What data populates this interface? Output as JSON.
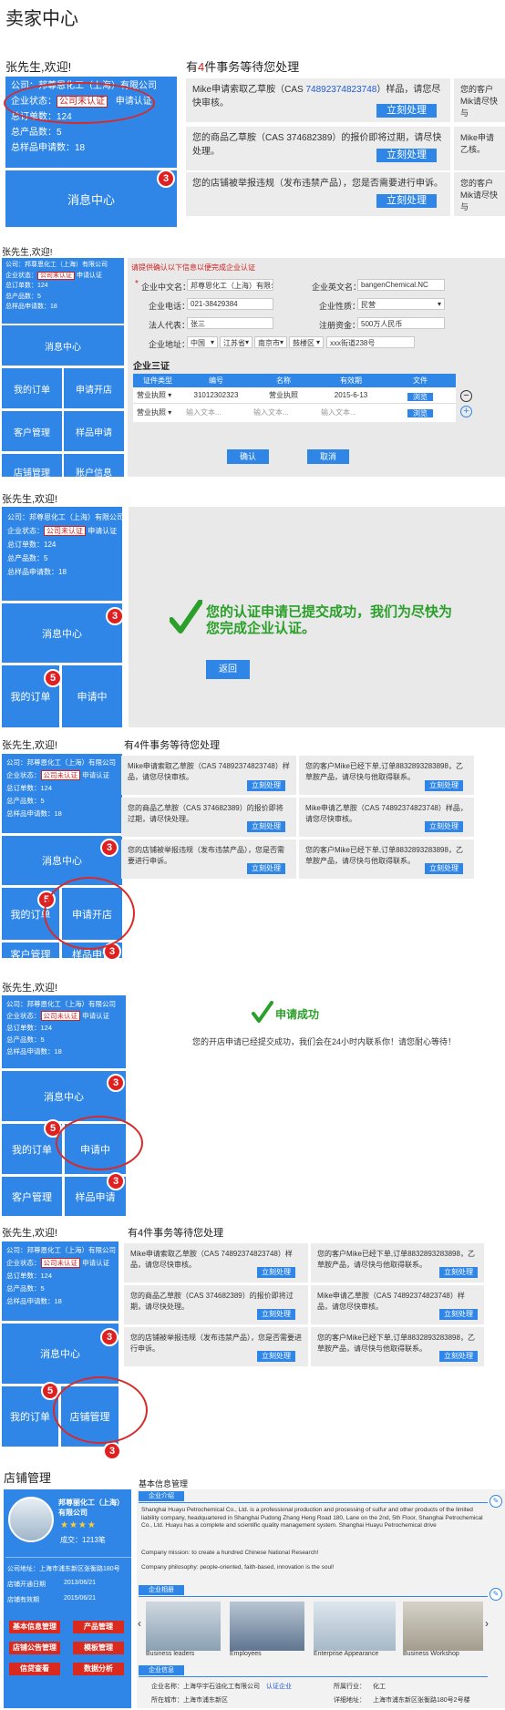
{
  "page_title": "卖家中心",
  "colors": {
    "primary": "#2f86e6",
    "badge": "#e02020",
    "annotation": "#d82a2a",
    "success": "#2aa02a"
  },
  "s1": {
    "greeting": "张先生,欢迎!",
    "company": "公司：邦尊恩化工（上海）有限公司",
    "status_label": "企业状态：",
    "status_value": "公司未认证",
    "apply_cert": "申请认证",
    "orders": "总订单数：124",
    "products": "总产品数：5",
    "samples": "总样品申请数：18",
    "message_center": "消息中心",
    "message_badge": "3",
    "tasks_prefix": "有",
    "tasks_count": "4",
    "tasks_suffix": "件事务等待您处理",
    "card1_a": "Mike申请索取乙草胺（CAS ",
    "card1_cas": "74892374823748",
    "card1_b": "）样品，请您尽快审核。",
    "card2": "您的商品乙草胺（CAS 374682389）的报价即将过期，请尽快处理。",
    "card3": "您的店铺被举报违规（发布违禁产品），您是否需要进行申诉。",
    "side1": "您的客户Mik请尽快与",
    "side2": "Mike申请乙核。",
    "side3": "您的客户Mik请尽快与",
    "process": "立刻处理"
  },
  "s2": {
    "greeting": "张先生,欢迎!",
    "company": "公司：邦尊恩化工（上海）有限公司",
    "status_label": "企业状态：",
    "status_value": "公司未认证",
    "apply_cert": "申请认证",
    "orders": "总订单数：124",
    "products": "总产品数：5",
    "samples": "总样品申请数：18",
    "message_center": "消息中心",
    "my_orders": "我的订单",
    "open_store": "申请开店",
    "customer_mgmt": "客户管理",
    "sample_apply": "样品申请",
    "store_mgmt": "店铺管理",
    "account_info": "账户信息",
    "notice": "请提供确认以下信息以便完成企业认证",
    "f_cn_name": "企业中文名：",
    "v_cn_name": "邦尊恩化工（上海）有限公司",
    "f_en_name": "企业英文名：",
    "v_en_name": "bangenChemical.NC",
    "f_phone": "企业电话：",
    "v_phone": "021-38429384",
    "f_nature": "企业性质：",
    "v_nature": "民营",
    "f_legal": "法人代表：",
    "v_legal": "张三",
    "f_capital": "注册资金：",
    "v_capital": "500万人民币",
    "f_address": "企业地址：",
    "v_country": "中国",
    "v_province": "江苏省",
    "v_city": "南京市",
    "v_district": "鼓楼区",
    "v_street": "xxx街道238号",
    "certs_title": "企业三证",
    "table_headers": [
      "证件类型",
      "编号",
      "名称",
      "有效期",
      "文件"
    ],
    "row1": [
      "营业执照",
      "31012302323",
      "营业执照",
      "2015-6-13",
      "浏览"
    ],
    "row2": [
      "营业执照",
      "输入文本...",
      "输入文本...",
      "输入文本...",
      "浏览"
    ],
    "confirm": "确认",
    "cancel": "取消"
  },
  "s3": {
    "greeting": "张先生,欢迎!",
    "company": "公司：邦尊恩化工（上海）有限公司",
    "status_label": "企业状态：",
    "status_value": "公司未认证",
    "apply_cert": "申请认证",
    "orders": "总订单数：124",
    "products": "总产品数：5",
    "samples": "总样品申请数：18",
    "message_center": "消息中心",
    "my_orders": "我的订单",
    "applying": "申请中",
    "success_msg": "您的认证申请已提交成功，我们为尽快为您完成企业认证。",
    "back": "返回",
    "badge3": "3",
    "badge5": "5"
  },
  "s4": {
    "greeting": "张先生,欢迎!",
    "company": "公司：邦尊恩化工（上海）有限公司",
    "status_label": "企业状态：",
    "status_value": "公司未认证",
    "apply_cert": "申请认证",
    "orders": "总订单数：124",
    "products": "总产品数：5",
    "samples": "总样品申请数：18",
    "message_center": "消息中心",
    "my_orders": "我的订单",
    "open_store": "申请开店",
    "customer_mgmt": "客户管理",
    "sample_apply": "样品申请",
    "tasks": "有4件事务等待您处理",
    "c1": "Mike申请索取乙草胺（CAS 74892374823748）样品，请您尽快审核。",
    "c2": "您的客户Mike已经下单,订单8832893283898，乙草胺产品，请尽快与他取得联系。",
    "c3": "您的商品乙草胺（CAS 374682389）的报价即将过期，请尽快处理。",
    "c4": "Mike申请乙草胺（CAS 74892374823748）样品，请您尽快审核。",
    "c5": "您的店铺被举报违规（发布违禁产品），您是否需要进行申诉。",
    "c6": "您的客户Mike已经下单,订单8832893283898，乙草胺产品，请尽快与他取得联系。",
    "process": "立刻处理"
  },
  "s5": {
    "greeting": "张先生,欢迎!",
    "company": "公司：邦尊恩化工（上海）有限公司",
    "status_label": "企业状态：",
    "status_value": "公司未认证",
    "apply_cert": "申请认证",
    "orders": "总订单数：124",
    "products": "总产品数：5",
    "samples": "总样品申请数：18",
    "message_center": "消息中心",
    "my_orders": "我的订单",
    "applying": "申请中",
    "customer_mgmt": "客户管理",
    "sample_apply": "样品申请",
    "success_title": "申请成功",
    "success_msg": "您的开店申请已经提交成功，我们会在24小时内联系你！请您耐心等待！"
  },
  "s6": {
    "greeting": "张先生,欢迎!",
    "company": "公司：邦尊恩化工（上海）有限公司",
    "status_label": "企业状态：",
    "status_value": "公司未认证",
    "apply_cert": "申请认证",
    "orders": "总订单数：124",
    "products": "总产品数：5",
    "samples": "总样品申请数：18",
    "message_center": "消息中心",
    "my_orders": "我的订单",
    "store_mgmt": "店铺管理",
    "tasks": "有4件事务等待您处理",
    "c1": "Mike申请索取乙草胺（CAS 74892374823748）样品，请您尽快审核。",
    "c2": "您的客户Mike已经下单,订单8832893283898，乙草胺产品，请尽快与他取得联系。",
    "c3": "您的商品乙草胺（CAS 374682389）的报价即将过期，请尽快处理。",
    "c4": "Mike申请乙草胺（CAS 74892374823748）样品，请您尽快审核。",
    "c5": "您的店铺被举报违规（发布违禁产品），您是否需要进行申诉。",
    "c6": "您的客户Mike已经下单,订单8832893283898，乙草胺产品，请尽快与他取得联系。",
    "process": "立刻处理"
  },
  "store": {
    "title": "店铺管理",
    "company_name": "邦尊丽化工（上海）有限公司",
    "stars": "★★★★",
    "deals": "成交：1213笔",
    "addr": "公司地址：上海市浦东新区张衡路180号",
    "opened_label": "店铺开通日期",
    "opened_value": "2013/06/21",
    "valid_label": "店铺有效期",
    "valid_value": "2015/06/21",
    "btn_basic": "基本信息管理",
    "btn_product": "产品管理",
    "btn_notice": "店铺公告管理",
    "btn_template": "模板管理",
    "btn_credit": "信贷查看",
    "btn_data": "数据分析",
    "basic_title": "基本信息管理",
    "intro_tab": "企业介绍",
    "intro_p1": "Shanghai Huayu Petrochemical Co., Ltd. is a professional production and processing of sulfur and other products of the limited liability company, headquartered in Shanghai Pudong Zhang Heng Road 180, Lane on the 2nd, 5th Floor, Shanghai Petrochemical Co., Ltd. Huayu has a complete and scientific quality management system. Shanghai Huayu Petrochemical drive",
    "intro_p2": "Company mission: to create a hundred Chinese National Research!",
    "intro_p3": "Company philosophy: people-oriented, faith-based, innovation is the soul!",
    "album_tab": "企业相册",
    "photos": [
      "Business leaders",
      "Employees",
      "Enterprise Appearance",
      "Business Workshop"
    ],
    "info_tab": "企业信息",
    "name_label": "企业名称：",
    "name_value": "上海华宇石油化工有限公司",
    "certified": "认证企业",
    "industry_label": "所属行业：",
    "industry_value": "化工",
    "city_label": "所在城市：",
    "city_value": "上海市浦东新区",
    "addr_label": "详细地址：",
    "addr_value": "上海市浦东新区张衡路180号2号楼"
  }
}
